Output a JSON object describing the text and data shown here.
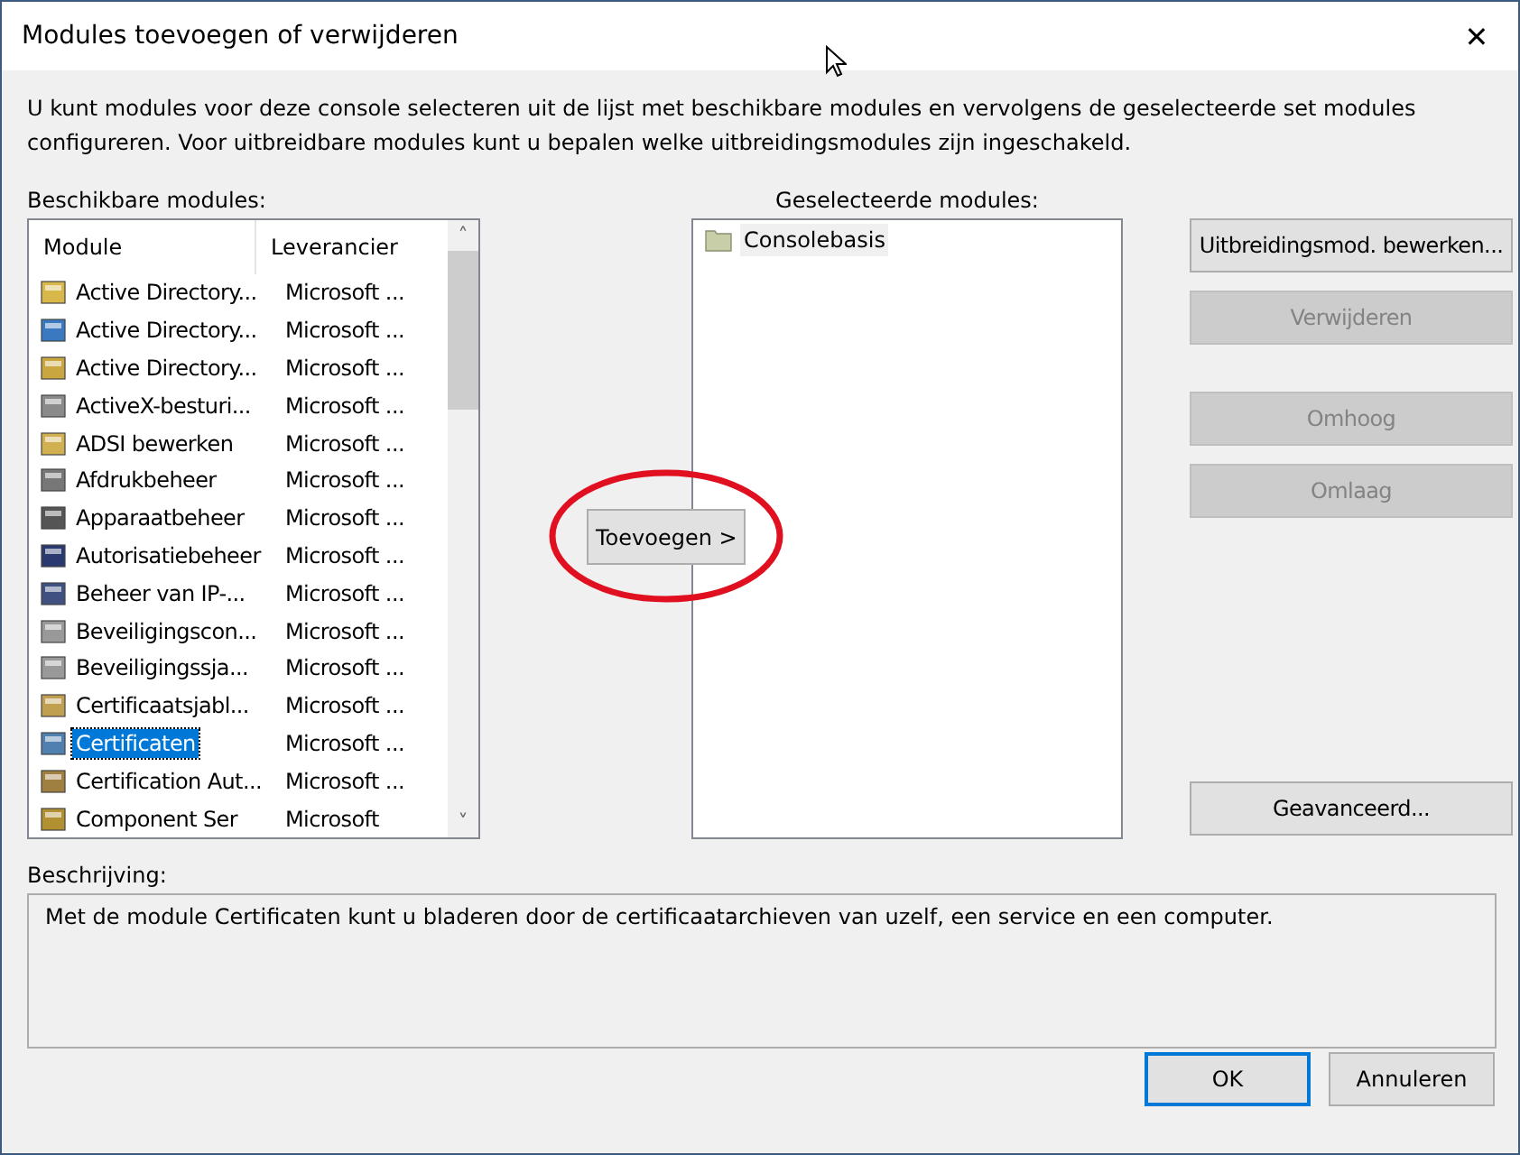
{
  "window": {
    "title": "Modules toevoegen of verwijderen",
    "close": "✕"
  },
  "intro": "U kunt modules voor deze console selecteren uit de lijst met beschikbare modules en vervolgens de geselecteerde set modules configureren. Voor uitbreidbare modules kunt u bepalen welke uitbreidingsmodules zijn ingeschakeld.",
  "available": {
    "label": "Beschikbare modules:",
    "columns": [
      "Module",
      "Leverancier"
    ],
    "scroll_up": "˄",
    "scroll_down": "˅",
    "rows": [
      {
        "module": "Active Directory...",
        "vendor": "Microsoft ...",
        "selected": false
      },
      {
        "module": "Active Directory...",
        "vendor": "Microsoft ...",
        "selected": false
      },
      {
        "module": "Active Directory...",
        "vendor": "Microsoft ...",
        "selected": false
      },
      {
        "module": "ActiveX-besturi...",
        "vendor": "Microsoft ...",
        "selected": false
      },
      {
        "module": "ADSI bewerken",
        "vendor": "Microsoft ...",
        "selected": false
      },
      {
        "module": "Afdrukbeheer",
        "vendor": "Microsoft ...",
        "selected": false
      },
      {
        "module": "Apparaatbeheer",
        "vendor": "Microsoft ...",
        "selected": false
      },
      {
        "module": "Autorisatiebeheer",
        "vendor": "Microsoft ...",
        "selected": false
      },
      {
        "module": "Beheer van IP-...",
        "vendor": "Microsoft ...",
        "selected": false
      },
      {
        "module": "Beveiligingscon...",
        "vendor": "Microsoft ...",
        "selected": false
      },
      {
        "module": "Beveiligingssja...",
        "vendor": "Microsoft ...",
        "selected": false
      },
      {
        "module": "Certificaatsjabl...",
        "vendor": "Microsoft ...",
        "selected": false
      },
      {
        "module": "Certificaten",
        "vendor": "Microsoft ...",
        "selected": true
      },
      {
        "module": "Certification Aut...",
        "vendor": "Microsoft ...",
        "selected": false
      },
      {
        "module": "Component Ser",
        "vendor": "Microsoft",
        "selected": false
      }
    ]
  },
  "add_button": {
    "label": "Toevoegen >",
    "disabled": false
  },
  "selected_modules": {
    "label": "Geselecteerde modules:",
    "items": [
      {
        "name": "Consolebasis",
        "selected": false
      }
    ]
  },
  "side_buttons": [
    {
      "label": "Uitbreidingsmod. bewerken...",
      "disabled": false
    },
    {
      "label": "Verwijderen",
      "disabled": true
    },
    {
      "label": "Omhoog",
      "disabled": true
    },
    {
      "label": "Omlaag",
      "disabled": true
    },
    {
      "label": "Geavanceerd...",
      "disabled": false
    }
  ],
  "description": {
    "label": "Beschrijving:",
    "text": "Met de module Certificaten kunt u bladeren door de certificaatarchieven van uzelf, een service en een computer."
  },
  "footer_buttons": [
    {
      "label": "OK",
      "default": true
    },
    {
      "label": "Annuleren",
      "default": false
    }
  ]
}
